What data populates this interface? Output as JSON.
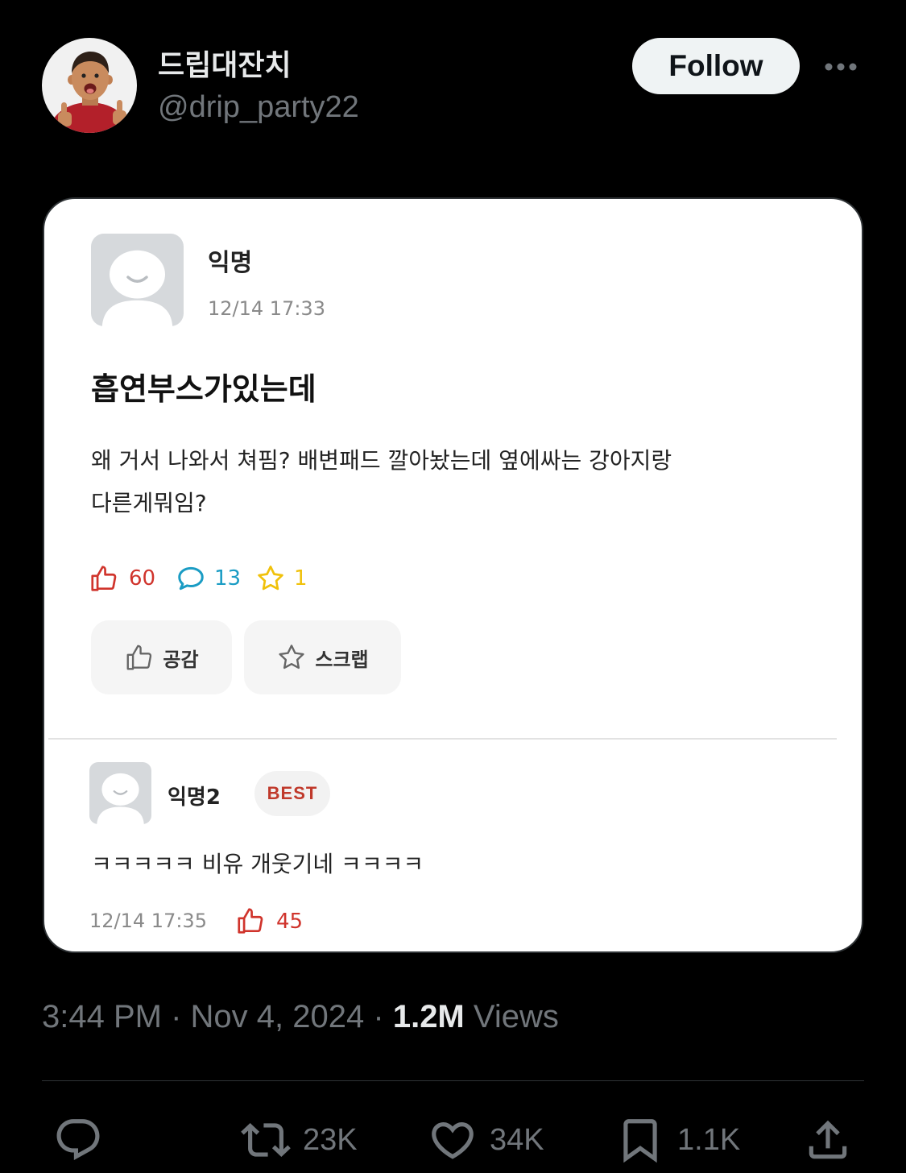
{
  "tweet": {
    "author": {
      "display_name": "드립대잔치",
      "handle": "@drip_party22"
    },
    "follow_label": "Follow",
    "more_icon": "more-dots-icon",
    "media": {
      "post": {
        "author": "익명",
        "timestamp": "12/14 17:33",
        "title": "흡연부스가있는데",
        "body_lines": [
          "왜 거서 나와서 쳐핌? 배변패드 깔아놨는데 옆에싸는 강아지랑",
          "다른게뭐임?"
        ],
        "stats": {
          "likes": "60",
          "comments": "13",
          "scraps": "1"
        },
        "buttons": {
          "like_label": "공감",
          "scrap_label": "스크랩"
        }
      },
      "comment": {
        "author": "익명2",
        "badge": "BEST",
        "text": "ㅋㅋㅋㅋㅋ 비유 개웃기네 ㅋㅋㅋㅋ",
        "timestamp": "12/14 17:35",
        "likes": "45"
      }
    },
    "meta": {
      "time": "3:44 PM",
      "separator": "·",
      "date": "Nov 4, 2024",
      "views_count": "1.2M",
      "views_label": "Views"
    },
    "actions": {
      "reply": {
        "icon": "reply-icon"
      },
      "retweet": {
        "icon": "retweet-icon",
        "count": "23K"
      },
      "like": {
        "icon": "heart-icon",
        "count": "34K"
      },
      "bookmark": {
        "icon": "bookmark-icon",
        "count": "1.1K"
      },
      "share": {
        "icon": "share-icon"
      }
    }
  },
  "colors": {
    "background": "#000000",
    "text_primary": "#e7e9ea",
    "text_secondary": "#71767b",
    "follow_bg": "#eff3f4",
    "follow_text": "#0f1419",
    "card_bg": "#ffffff",
    "like_red": "#d0342c",
    "comment_teal": "#1a9cc4",
    "star_yellow": "#f0c10a",
    "best_red": "#c0392b"
  }
}
